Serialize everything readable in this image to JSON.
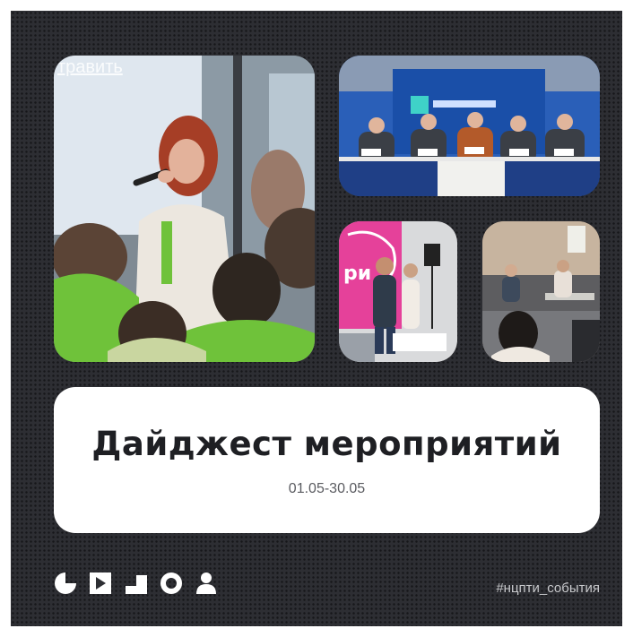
{
  "title": "Дайджест мероприятий",
  "date_range": "01.05-30.05",
  "hashtag": "#нцпти_события",
  "photo_overlay_text": "травить",
  "logo_icons": [
    "half-circle-icon",
    "play-square-icon",
    "stairs-icon",
    "ring-icon",
    "person-icon"
  ],
  "colors": {
    "background": "#2d2e33",
    "panel": "#ffffff",
    "title": "#1e1f23",
    "accent_green": "#6fc23a",
    "press_blue": "#1a4fa8"
  }
}
